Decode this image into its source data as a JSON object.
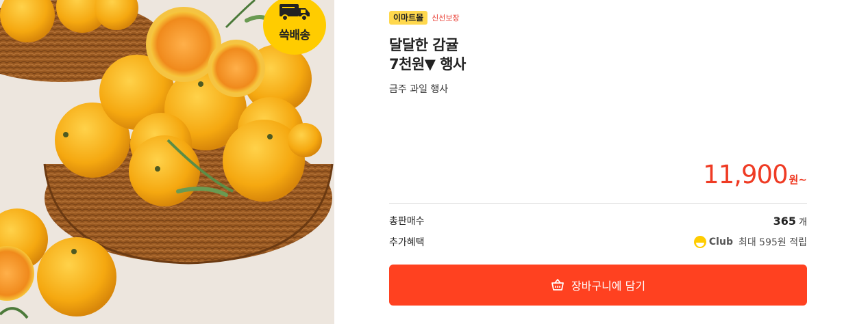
{
  "image": {
    "alt": "감귤 바구니 상품 이미지"
  },
  "badge": {
    "label": "쓱배송",
    "color": "#ffcc00"
  },
  "product": {
    "mall_badge": "이마트몰",
    "fresh_label": "신선보장",
    "title_line1": "달달한 감귤",
    "title_line2": "7천원▼ 행사",
    "subtitle": "금주 과일 행사",
    "price": "11,900",
    "price_unit": "원~",
    "price_color": "#ef3b24"
  },
  "details": {
    "sold_label": "총판매수",
    "sold_count": "365",
    "sold_unit": "개",
    "benefit_label": "추가혜택",
    "club_name": "Club",
    "club_text": "최대 595원 적립"
  },
  "cart": {
    "label": "장바구니에 담기",
    "color": "#ff4120"
  }
}
